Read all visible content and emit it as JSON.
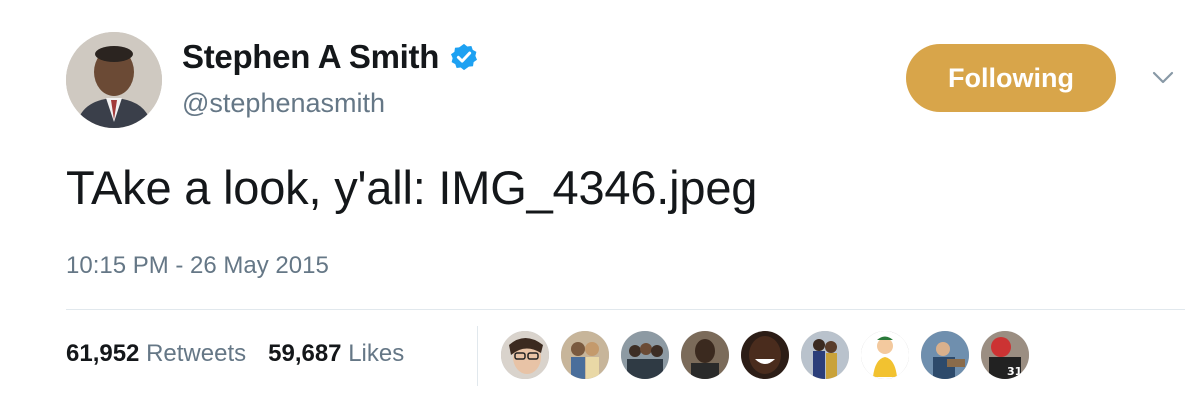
{
  "author": {
    "display_name": "Stephen A Smith",
    "handle": "@stephenasmith",
    "verified": true
  },
  "follow_button": {
    "label": "Following",
    "color": "#d8a54a"
  },
  "tweet": {
    "text": "TAke a look, y'all: IMG_4346.jpeg",
    "timestamp": "10:15 PM - 26 May 2015"
  },
  "stats": {
    "retweets_count": "61,952",
    "retweets_label": "Retweets",
    "likes_count": "59,687",
    "likes_label": "Likes"
  },
  "likers": [
    {
      "icon": "avatar-woman-glasses"
    },
    {
      "icon": "avatar-couple"
    },
    {
      "icon": "avatar-group"
    },
    {
      "icon": "avatar-man-dark"
    },
    {
      "icon": "avatar-man-smiling"
    },
    {
      "icon": "avatar-couple-formal"
    },
    {
      "icon": "avatar-cartoon-yellow"
    },
    {
      "icon": "avatar-man-fishing"
    },
    {
      "icon": "avatar-football-player"
    }
  ],
  "colors": {
    "text_primary": "#14171a",
    "text_secondary": "#657786",
    "verified_blue": "#1da1f2"
  }
}
